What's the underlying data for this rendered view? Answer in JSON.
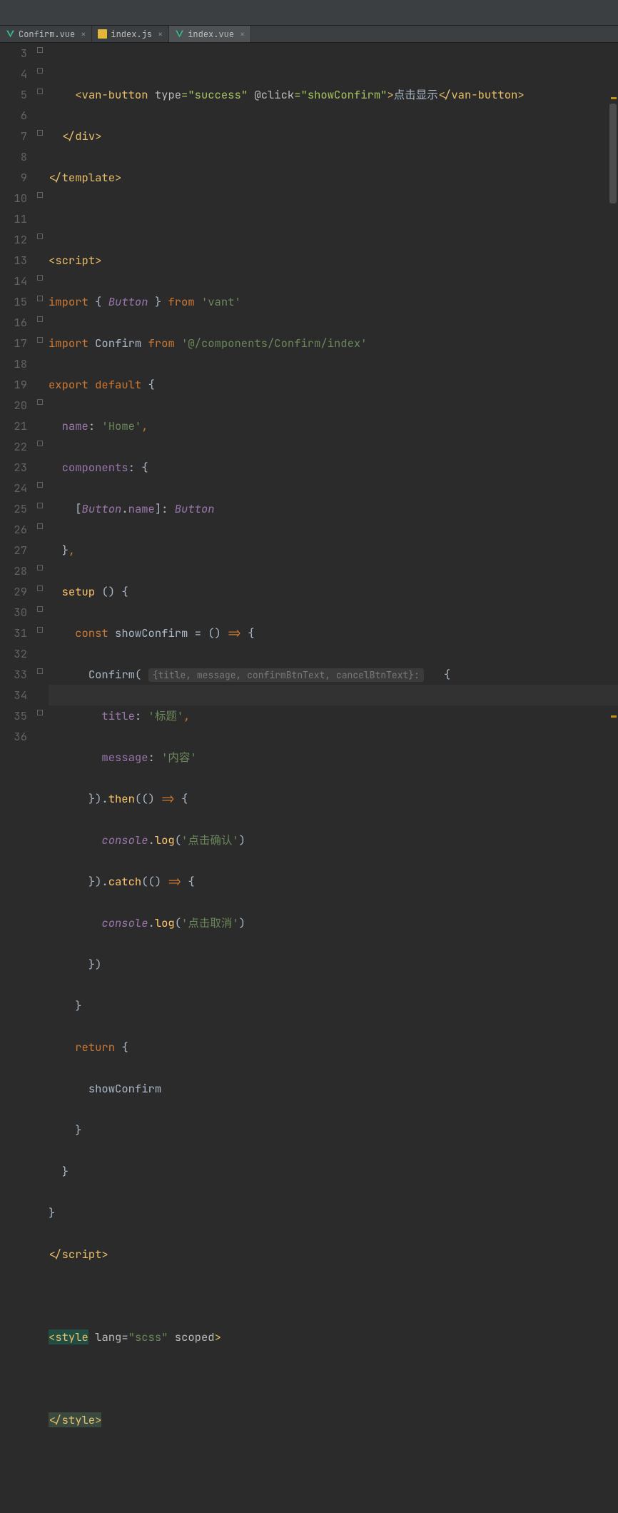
{
  "tabs": [
    {
      "label": "Confirm.vue",
      "type": "vue",
      "active": false
    },
    {
      "label": "index.js",
      "type": "js",
      "active": false
    },
    {
      "label": "index.vue",
      "type": "vue",
      "active": true
    }
  ],
  "gutter_start": 3,
  "gutter_end": 36,
  "code": {
    "l3_btn_open": "van-button",
    "l3_attr_type": "type",
    "l3_val_type": "success",
    "l3_attr_click": "@click",
    "l3_val_click": "showConfirm",
    "l3_text": "点击显示",
    "l3_btn_close": "van-button",
    "l4_div": "div",
    "l5_template": "template",
    "l7_script": "script",
    "l8_import": "import",
    "l8_button": "Button",
    "l8_from": "from",
    "l8_vant": "'vant'",
    "l9_import": "import",
    "l9_confirm": "Confirm",
    "l9_from": "from",
    "l9_path": "'@/components/Confirm/index'",
    "l10_export": "export",
    "l10_default": "default",
    "l11_name": "name",
    "l11_val": "'Home'",
    "l12_components": "components",
    "l13_button": "Button",
    "l13_name": "name",
    "l13_button2": "Button",
    "l15_setup": "setup",
    "l16_const": "const",
    "l16_show": "showConfirm",
    "l17_confirm": "Confirm",
    "l17_hint": "{title, message, confirmBtnText, cancelBtnText}:",
    "l18_title": "title",
    "l18_val": "'标题'",
    "l19_message": "message",
    "l19_val": "'内容'",
    "l20_then": "then",
    "l21_console": "console",
    "l21_log": "log",
    "l21_val": "'点击确认'",
    "l22_catch": "catch",
    "l23_console": "console",
    "l23_log": "log",
    "l23_val": "'点击取消'",
    "l26_return": "return",
    "l27_show": "showConfirm",
    "l31_script": "script",
    "l33_style": "style",
    "l33_lang": "lang",
    "l33_lang_val": "\"scss\"",
    "l33_scoped": "scoped",
    "l35_style": "style"
  }
}
